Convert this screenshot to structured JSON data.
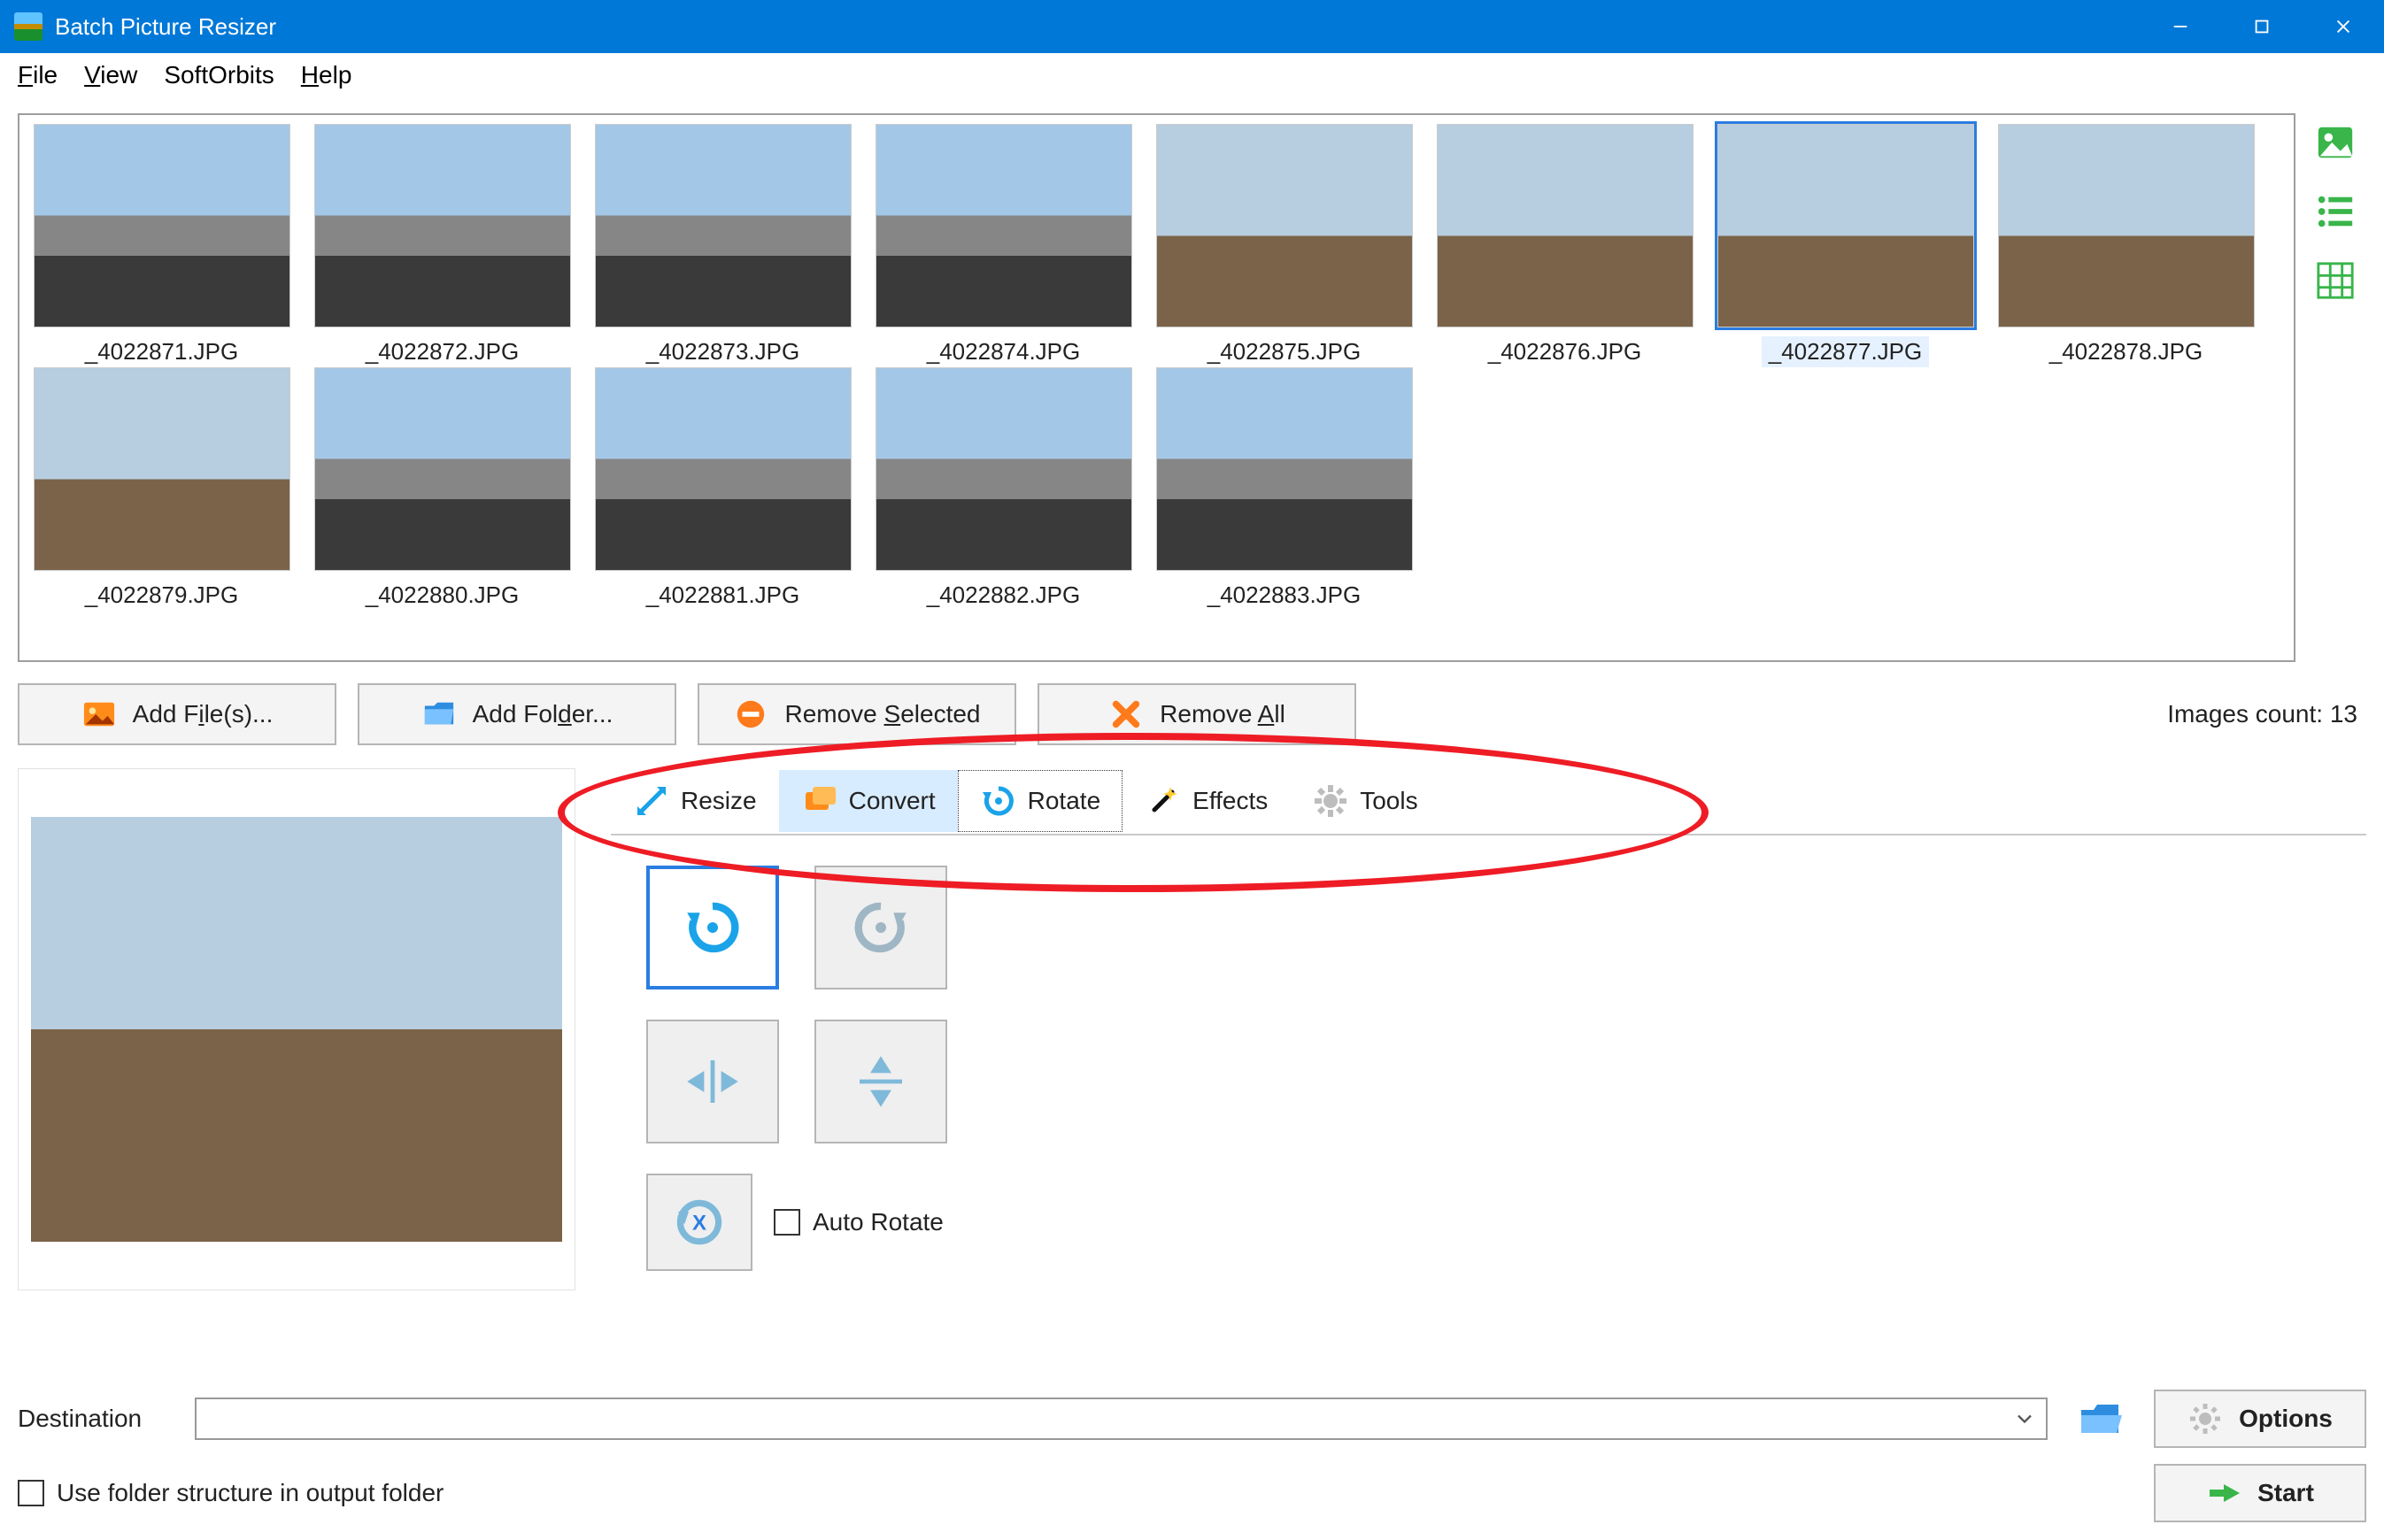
{
  "app": {
    "title": "Batch Picture Resizer"
  },
  "menu": {
    "file": "File",
    "view": "View",
    "softorbits": "SoftOrbits",
    "help": "Help"
  },
  "thumbs": [
    {
      "label": "_4022871.JPG",
      "type": "city",
      "selected": false
    },
    {
      "label": "_4022872.JPG",
      "type": "city",
      "selected": false
    },
    {
      "label": "_4022873.JPG",
      "type": "city",
      "selected": false
    },
    {
      "label": "_4022874.JPG",
      "type": "city",
      "selected": false
    },
    {
      "label": "_4022875.JPG",
      "type": "plain",
      "selected": false
    },
    {
      "label": "_4022876.JPG",
      "type": "plain",
      "selected": false
    },
    {
      "label": "_4022877.JPG",
      "type": "plain",
      "selected": true
    },
    {
      "label": "_4022878.JPG",
      "type": "plain",
      "selected": false
    },
    {
      "label": "_4022879.JPG",
      "type": "plain",
      "selected": false
    },
    {
      "label": "_4022880.JPG",
      "type": "city",
      "selected": false
    },
    {
      "label": "_4022881.JPG",
      "type": "city",
      "selected": false
    },
    {
      "label": "_4022882.JPG",
      "type": "city",
      "selected": false
    },
    {
      "label": "_4022883.JPG",
      "type": "city",
      "selected": false
    }
  ],
  "toolbar": {
    "add_files": "Add File(s)...",
    "add_folder": "Add Folder...",
    "remove_selected": "Remove Selected",
    "remove_all": "Remove All",
    "counter_prefix": "Images count: ",
    "counter_value": "13"
  },
  "tabs": {
    "resize": "Resize",
    "convert": "Convert",
    "rotate": "Rotate",
    "effects": "Effects",
    "tools": "Tools",
    "active": "rotate",
    "hover": "convert"
  },
  "rotate_panel": {
    "auto_rotate": "Auto Rotate",
    "auto_rotate_checked": false,
    "active_button": "rotate-left"
  },
  "bottom": {
    "destination_label": "Destination",
    "destination_value": "",
    "folder_structure": "Use folder structure in output folder",
    "folder_structure_checked": false,
    "options": "Options",
    "start": "Start"
  }
}
